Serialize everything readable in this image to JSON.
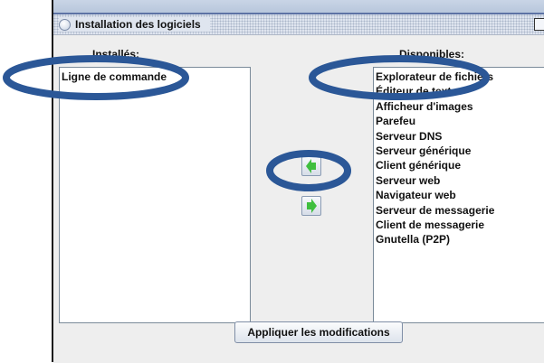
{
  "window": {
    "title": "Installation des logiciels"
  },
  "installed": {
    "header": "Installés:",
    "items": [
      "Ligne de commande"
    ]
  },
  "available": {
    "header": "Disponibles:",
    "items": [
      "Explorateur de fichiers",
      "Éditeur de texte",
      "Afficheur d'images",
      "Parefeu",
      "Serveur DNS",
      "Serveur générique",
      "Client générique",
      "Serveur web",
      "Navigateur web",
      "Serveur de messagerie",
      "Client de messagerie",
      "Gnutella (P2P)"
    ]
  },
  "buttons": {
    "apply_label": "Appliquer les modifications"
  },
  "icons": {
    "move_to_installed": "arrow-left-icon",
    "move_to_available": "arrow-right-icon"
  },
  "colors": {
    "arrow_green": "#3fbf3f",
    "highlight_ellipse": "#2b5797"
  }
}
